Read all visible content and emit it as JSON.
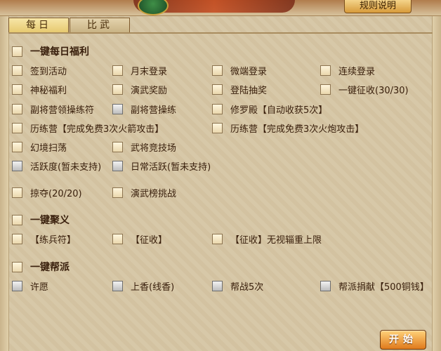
{
  "header": {
    "rules_label": "规则说明"
  },
  "tabs": [
    {
      "label": "每日"
    },
    {
      "label": "比武"
    }
  ],
  "groups": {
    "daily": {
      "title": "一键每日福利",
      "items": {
        "sign_in": "签到活动",
        "month_end_login": "月末登录",
        "weiduan_login": "微端登录",
        "consecutive_login": "连续登录",
        "mystery_welfare": "神秘福利",
        "drill_reward": "演武奖励",
        "login_lottery": "登陆抽奖",
        "one_click_levy": "一键征收(30/30)",
        "deputy_camp_token": "副将营领操练符",
        "deputy_camp_drill": "副将营操练",
        "asura_hall": "修罗殿【自动收获5次】",
        "trial_camp_arrow": "历练营【完成免费3次火箭攻击】",
        "trial_camp_cannon": "历练营【完成免费3次火炮攻击】",
        "illusion_sweep": "幻境扫荡",
        "general_arena": "武将竞技场",
        "activity_level": "活跃度(暂未支持)",
        "daily_activity": "日常活跃(暂未支持)",
        "plunder": "掠夺(20/20)",
        "drill_ranking": "演武榜挑战"
      }
    },
    "gather": {
      "title": "一键聚义",
      "items": {
        "train_token": "【练兵符】",
        "levy": "【征收】",
        "levy_unlimited": "【征收】无视辎重上限"
      }
    },
    "faction": {
      "title": "一键帮派",
      "items": {
        "wish": "许愿",
        "incense": "上香(线香)",
        "help_war": "帮战5次",
        "donate": "帮派捐献【500铜钱】"
      }
    }
  },
  "footer": {
    "start_label": "开始"
  }
}
